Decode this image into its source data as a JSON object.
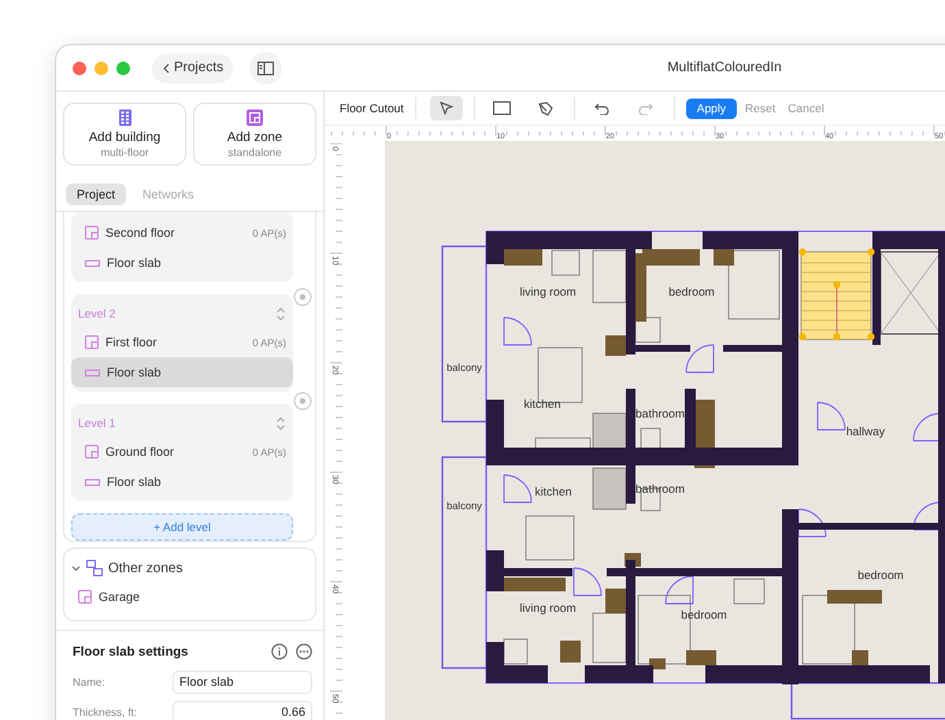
{
  "window": {
    "title": "MultiflatColouredIn",
    "back_label": "Projects"
  },
  "sidebar": {
    "actions": [
      {
        "kind": "building",
        "label": "Add building",
        "sublabel": "multi-floor"
      },
      {
        "kind": "zone",
        "label": "Add zone",
        "sublabel": "standalone"
      }
    ],
    "tabs": [
      {
        "label": "Project",
        "selected": true
      },
      {
        "label": "Networks",
        "selected": false
      }
    ],
    "levels": [
      {
        "rows": [
          {
            "kind": "floor",
            "label": "Second floor",
            "count": "0 AP(s)",
            "selected": false
          },
          {
            "kind": "slab",
            "label": "Floor slab",
            "selected": false
          }
        ]
      },
      {
        "label": "Level 2",
        "rows": [
          {
            "kind": "floor",
            "label": "First floor",
            "count": "0 AP(s)",
            "selected": false
          },
          {
            "kind": "slab",
            "label": "Floor slab",
            "selected": true
          }
        ]
      },
      {
        "label": "Level 1",
        "rows": [
          {
            "kind": "floor",
            "label": "Ground floor",
            "count": "0 AP(s)",
            "selected": false
          },
          {
            "kind": "slab",
            "label": "Floor slab",
            "selected": false
          }
        ]
      }
    ],
    "add_level": "+ Add level",
    "other_zones": {
      "label": "Other zones",
      "expanded": true,
      "items": [
        {
          "kind": "floor",
          "label": "Garage",
          "selected": false
        }
      ]
    },
    "settings": {
      "title": "Floor slab settings",
      "fields": [
        {
          "kind": "text",
          "label": "Name:",
          "value": "Floor slab"
        },
        {
          "kind": "number",
          "label": "Thickness, ft:",
          "value": "0.66"
        }
      ]
    }
  },
  "toolbar": {
    "title": "Floor Cutout",
    "tools": [
      {
        "kind": "pointer",
        "selected": true
      },
      {
        "kind": "rectangle",
        "selected": false
      },
      {
        "kind": "polygon",
        "selected": false
      }
    ],
    "history": [
      {
        "kind": "undo",
        "disabled": false
      },
      {
        "kind": "redo",
        "disabled": true
      }
    ],
    "apply": "Apply",
    "reset": "Reset",
    "cancel": "Cancel"
  },
  "rulers": {
    "x_labels": [
      "0",
      "10",
      "20",
      "30",
      "40",
      "50"
    ],
    "y_labels": [
      "0",
      "10",
      "20",
      "30",
      "40",
      "50"
    ]
  },
  "floor_plan": {
    "rooms": [
      "living room",
      "bedroom",
      "balcony",
      "kitchen",
      "bathroom",
      "hallway",
      "balcony",
      "kitchen",
      "bathroom",
      "living room",
      "bedroom",
      "bedroom"
    ]
  }
}
